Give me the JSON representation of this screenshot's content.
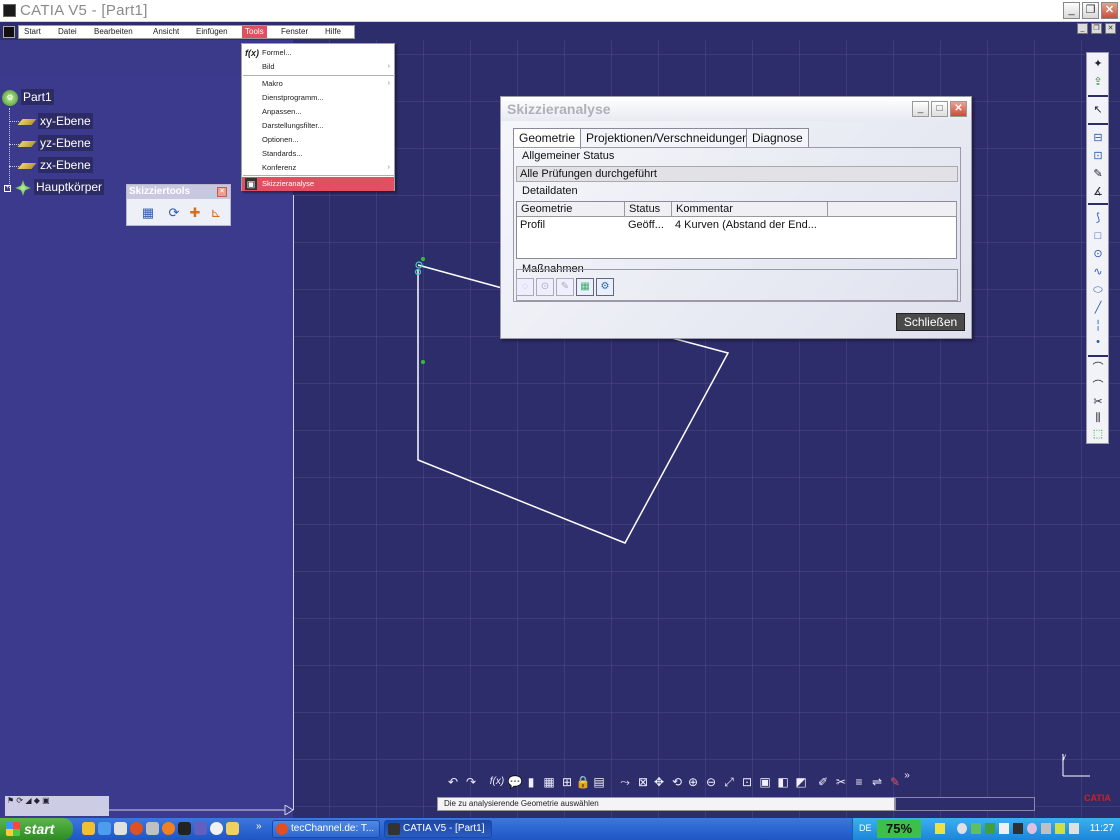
{
  "window": {
    "title": "CATIA V5 - [Part1]"
  },
  "menubar": {
    "items": [
      {
        "label": "Start"
      },
      {
        "label": "Datei"
      },
      {
        "label": "Bearbeiten"
      },
      {
        "label": "Ansicht"
      },
      {
        "label": "Einfügen"
      },
      {
        "label": "Tools"
      },
      {
        "label": "Fenster"
      },
      {
        "label": "Hilfe"
      }
    ]
  },
  "tools_menu": {
    "items": [
      {
        "label": "Formel...",
        "icon": "formula-icon"
      },
      {
        "label": "Bild",
        "submenu": "›"
      },
      {
        "label": "Makro",
        "submenu": "›"
      },
      {
        "label": "Dienstprogramm..."
      },
      {
        "label": "Anpassen..."
      },
      {
        "label": "Darstellungsfilter..."
      },
      {
        "label": "Optionen..."
      },
      {
        "label": "Standards..."
      },
      {
        "label": "Konferenz",
        "submenu": "›"
      },
      {
        "label": "Skizzieranalyse",
        "icon": "sketch-analysis-icon"
      }
    ]
  },
  "tree": {
    "root": "Part1",
    "children": [
      "xy-Ebene",
      "yz-Ebene",
      "zx-Ebene",
      "Hauptkörper"
    ]
  },
  "sketch_tools": {
    "title": "Skizziertools"
  },
  "dialog": {
    "title": "Skizzieranalyse",
    "tabs": [
      "Geometrie",
      "Projektionen/Verschneidungen",
      "Diagnose"
    ],
    "general_status_label": "Allgemeiner Status",
    "general_status_value": "Alle Prüfungen durchgeführt",
    "details_label": "Detaildaten",
    "columns": [
      "Geometrie",
      "Status",
      "Kommentar"
    ],
    "rows": [
      {
        "geometry": "Profil",
        "status": "Geöff...",
        "comment": "4 Kurven (Abstand der End..."
      }
    ],
    "actions_label": "Maßnahmen",
    "close_label": "Schließen"
  },
  "statusbar": {
    "text": "Die zu analysierende Geometrie auswählen"
  },
  "axis": {
    "y_label": "y"
  },
  "logo": {
    "text": "CATIA"
  },
  "taskbar": {
    "start_label": "start",
    "more": "»",
    "tasks": [
      {
        "label": "tecChannel.de: T..."
      },
      {
        "label": "CATIA V5 - [Part1]"
      }
    ],
    "language": "DE",
    "battery": "75%",
    "clock": "11:27"
  },
  "colors": {
    "canvas": "#2e2d6b",
    "panel": "#3b3a8c",
    "menu_highlight": "#e05060",
    "taskbar": "#2556c8",
    "start": "#3a9a2e"
  }
}
